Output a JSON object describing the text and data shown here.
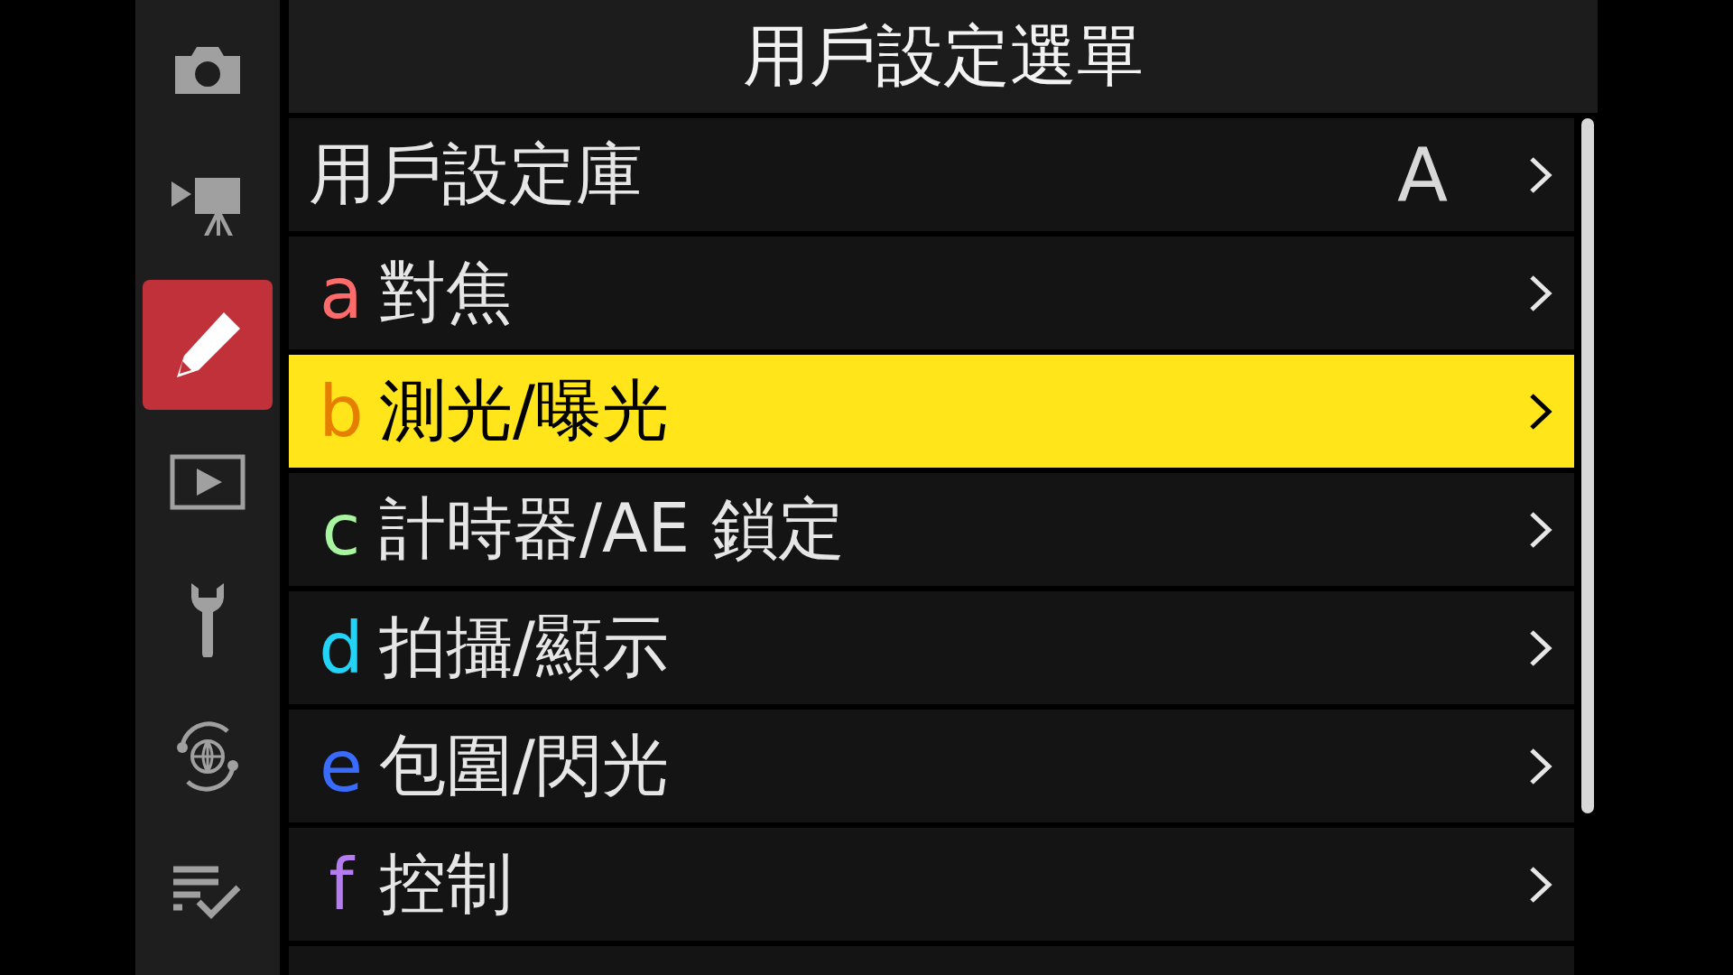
{
  "sidebar": {
    "items": [
      {
        "kind": "camera",
        "selected": false
      },
      {
        "kind": "movie",
        "selected": false
      },
      {
        "kind": "custom",
        "selected": true
      },
      {
        "kind": "playback",
        "selected": false
      },
      {
        "kind": "setup",
        "selected": false
      },
      {
        "kind": "network",
        "selected": false
      },
      {
        "kind": "mymenu",
        "selected": false
      }
    ]
  },
  "title": "用戶設定選單",
  "rows": [
    {
      "label": "用戶設定庫",
      "value": "A",
      "selected": false
    },
    {
      "letter": "a",
      "color": "#ff6b6b",
      "label": "對焦",
      "selected": false
    },
    {
      "letter": "b",
      "color": "#e67e00",
      "label": "測光/曝光",
      "selected": true
    },
    {
      "letter": "c",
      "color": "#a8f5a0",
      "label": "計時器/AE 鎖定",
      "selected": false
    },
    {
      "letter": "d",
      "color": "#22d3f5",
      "label": "拍攝/顯示",
      "selected": false
    },
    {
      "letter": "e",
      "color": "#3a6bff",
      "label": "包圍/閃光",
      "selected": false
    },
    {
      "letter": "f",
      "color": "#b57cf0",
      "label": "控制",
      "selected": false
    }
  ]
}
